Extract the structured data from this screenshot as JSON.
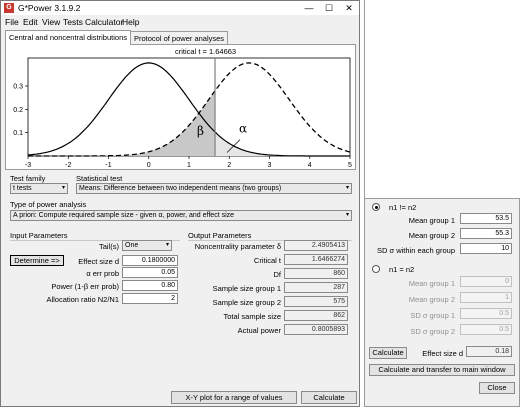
{
  "window": {
    "title": "G*Power 3.1.9.2",
    "icon_glyph": "G",
    "controls": {
      "minimize": "—",
      "maximize": "☐",
      "close": "✕"
    }
  },
  "menu": [
    "File",
    "Edit",
    "View",
    "Tests",
    "Calculator",
    "Help"
  ],
  "tabs": [
    "Central and noncentral distributions",
    "Protocol of power analyses"
  ],
  "plot": {
    "critical_label": "critical t = 1.64663",
    "beta_label": "β",
    "alpha_label": "α"
  },
  "chart_data": {
    "type": "line",
    "series": [
      {
        "line": "solid",
        "center": 0
      },
      {
        "line": "dashed",
        "center": 2.49
      }
    ],
    "critical_t": 1.64663,
    "xlim": [
      -3,
      5
    ],
    "ylim": [
      0,
      0.42
    ],
    "x_ticks": [
      "-3",
      "-2",
      "-1",
      "0",
      "1",
      "2",
      "3",
      "4",
      "5"
    ],
    "y_ticks": [
      "0.3",
      "0.2",
      "0.1"
    ],
    "grid": false
  },
  "test_family": {
    "label": "Test family",
    "value": "t tests"
  },
  "statistical_test": {
    "label": "Statistical test",
    "value": "Means: Difference between two independent means (two groups)"
  },
  "analysis_type": {
    "label": "Type of power analysis",
    "value": "A priori: Compute required sample size - given α, power, and effect size"
  },
  "input": {
    "heading": "Input Parameters",
    "tails_label": "Tail(s)",
    "tails_value": "One",
    "determine_label": "Determine =>",
    "effect_label": "Effect size d",
    "effect_value": "0.1800000",
    "alpha_label": "α err prob",
    "alpha_value": "0.05",
    "power_label": "Power (1-β err prob)",
    "power_value": "0.80",
    "ratio_label": "Allocation ratio N2/N1",
    "ratio_value": "2"
  },
  "output": {
    "heading": "Output Parameters",
    "rows": [
      {
        "label": "Noncentrality parameter δ",
        "value": "2.4905413"
      },
      {
        "label": "Critical t",
        "value": "1.6466274"
      },
      {
        "label": "Df",
        "value": "860"
      },
      {
        "label": "Sample size group 1",
        "value": "287"
      },
      {
        "label": "Sample size group 2",
        "value": "575"
      },
      {
        "label": "Total sample size",
        "value": "862"
      },
      {
        "label": "Actual power",
        "value": "0.8005893"
      }
    ]
  },
  "bottom": {
    "xy_plot": "X-Y plot for a range of values",
    "calculate": "Calculate"
  },
  "side": {
    "option1_label": "n1 != n2",
    "mean1_label": "Mean group 1",
    "mean1_value": "53.5",
    "mean2_label": "Mean group 2",
    "mean2_value": "55.3",
    "sd_label": "SD σ within each group",
    "sd_value": "10",
    "option2_label": "n1 = n2",
    "mean1b_label": "Mean group 1",
    "mean1b_value": "0",
    "mean2b_label": "Mean group 2",
    "mean2b_value": "1",
    "sd1_label": "SD σ group 1",
    "sd1_value": "0.5",
    "sd2_label": "SD σ group 2",
    "sd2_value": "0.5",
    "calculate": "Calculate",
    "effect_label": "Effect size d",
    "effect_value": "0.18",
    "transfer": "Calculate and transfer to main window",
    "close": "Close"
  }
}
